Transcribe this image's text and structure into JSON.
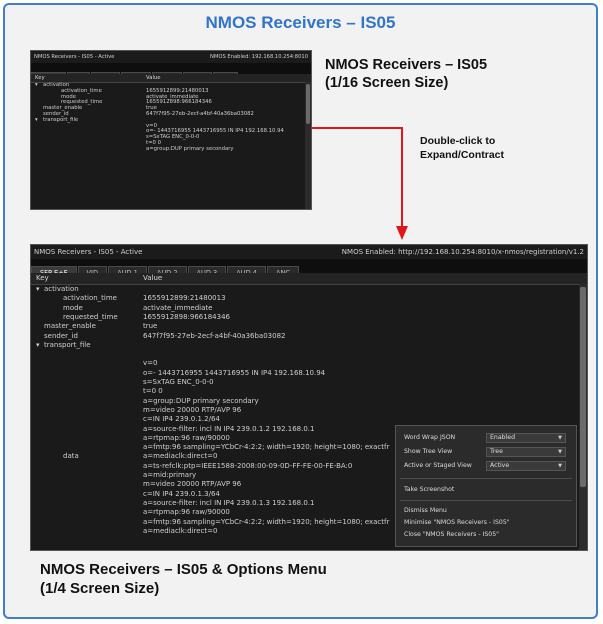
{
  "page": {
    "title": "NMOS Receivers – IS05",
    "small_caption": [
      "NMOS Receivers – IS05",
      "(1/16 Screen Size)"
    ],
    "hint": [
      "Double-click to",
      "Expand/Contract"
    ],
    "large_caption": [
      "NMOS Receivers – IS05 & Options Menu",
      "(1/4 Screen Size)"
    ]
  },
  "colors": {
    "accent": "#2f75c8",
    "arrow": "#e0161b",
    "panel_bg": "#0e0e0e"
  },
  "small": {
    "title": "NMOS Receivers - IS05 - Active",
    "status": "NMOS Enabled: 192.168.10.254:8010",
    "tabs": [
      "SFP E+F",
      "VID",
      "AUD 1",
      "AUD 2",
      "AUD 3",
      "AUD 4",
      "ANC"
    ],
    "columns": [
      "Key",
      "Value"
    ],
    "rows": [
      {
        "key": "activation",
        "arrow": "▾",
        "value": ""
      },
      {
        "key": "activation_time",
        "value": "1655912899:21480013"
      },
      {
        "key": "mode",
        "value": "activate_immediate"
      },
      {
        "key": "requested_time",
        "value": "1655912898:966184346"
      },
      {
        "key": "master_enable",
        "value": "true"
      },
      {
        "key": "sender_id",
        "value": "647f7f95-27eb-2ecf-a4bf-40a36ba03082"
      },
      {
        "key": "transport_file",
        "arrow": "▾",
        "value": ""
      },
      {
        "key": "",
        "value": "v=0"
      },
      {
        "key": "",
        "value": "o=- 1443716955 1443716955 IN IP4 192.168.10.94"
      },
      {
        "key": "",
        "value": "s=SxTAG ENC_0-0-0"
      },
      {
        "key": "",
        "value": "t=0 0"
      },
      {
        "key": "",
        "value": "a=group:DUP primary secondary"
      }
    ]
  },
  "large": {
    "title": "NMOS Receivers - IS05 - Active",
    "status": "NMOS Enabled: http://192.168.10.254:8010/x-nmos/registration/v1.2",
    "tabs": [
      "SFP E+F",
      "VID",
      "AUD 1",
      "AUD 2",
      "AUD 3",
      "AUD 4",
      "ANC"
    ],
    "columns": [
      "Key",
      "Value"
    ],
    "rows": [
      {
        "key": "activation",
        "arrow": "▾",
        "value": ""
      },
      {
        "key": "activation_time",
        "value": "1655912899:21480013"
      },
      {
        "key": "mode",
        "value": "activate_immediate"
      },
      {
        "key": "requested_time",
        "value": "1655912898:966184346"
      },
      {
        "key": "master_enable",
        "value": "true"
      },
      {
        "key": "sender_id",
        "value": "647f7f95-27eb-2ecf-a4bf-40a36ba03082"
      },
      {
        "key": "transport_file",
        "arrow": "▾",
        "value": ""
      },
      {
        "key": "",
        "value": ""
      },
      {
        "key": "",
        "value": "v=0"
      },
      {
        "key": "",
        "value": "o=- 1443716955 1443716955 IN IP4 192.168.10.94"
      },
      {
        "key": "",
        "value": "s=SxTAG ENC_0-0-0"
      },
      {
        "key": "",
        "value": "t=0 0"
      },
      {
        "key": "",
        "value": "a=group:DUP primary secondary"
      },
      {
        "key": "",
        "value": "m=video 20000 RTP/AVP 96"
      },
      {
        "key": "",
        "value": "c=IN IP4 239.0.1.2/64"
      },
      {
        "key": "",
        "value": "a=source-filter: incl IN IP4 239.0.1.2 192.168.0.1"
      },
      {
        "key": "",
        "value": "a=rtpmap:96 raw/90000"
      },
      {
        "key": "",
        "value": "a=fmtp:96 sampling=YCbCr-4:2:2; width=1920; height=1080; exactfr"
      },
      {
        "key": "data",
        "value": "a=mediaclk:direct=0"
      },
      {
        "key": "",
        "value": "a=ts-refclk:ptp=IEEE1588-2008:00-09-0D-FF-FE-00-FE-BA:0"
      },
      {
        "key": "",
        "value": "a=mid:primary"
      },
      {
        "key": "",
        "value": "m=video 20000 RTP/AVP 96"
      },
      {
        "key": "",
        "value": "c=IN IP4 239.0.1.3/64"
      },
      {
        "key": "",
        "value": "a=source-filter: incl IN IP4 239.0.1.3 192.168.0.1"
      },
      {
        "key": "",
        "value": "a=rtpmap:96 raw/90000"
      },
      {
        "key": "",
        "value": "a=fmtp:96 sampling=YCbCr-4:2:2; width=1920; height=1080; exactfr"
      },
      {
        "key": "",
        "value": "a=mediaclk:direct=0"
      }
    ]
  },
  "menu": {
    "options": [
      {
        "label": "Word Wrap JSON",
        "value": "Enabled"
      },
      {
        "label": "Show Tree View",
        "value": "Tree"
      },
      {
        "label": "Active or Staged View",
        "value": "Active"
      }
    ],
    "actions_1": [
      "Take Screenshot"
    ],
    "actions_2": [
      "Dismiss Menu",
      "Minimise \"NMOS Receivers - IS05\"",
      "Close \"NMOS Receivers - IS05\""
    ]
  }
}
